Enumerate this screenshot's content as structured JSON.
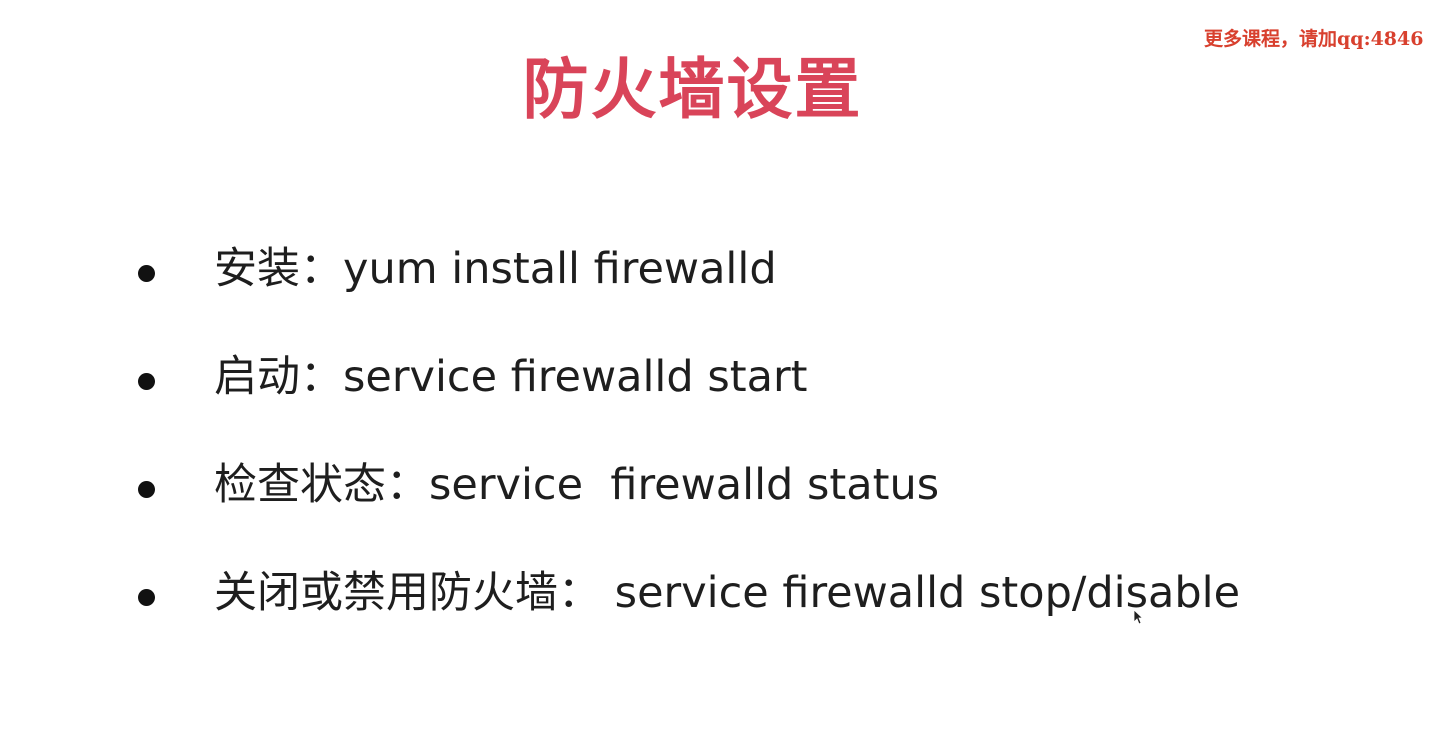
{
  "watermark": {
    "text": "更多课程，请加qq:4846"
  },
  "slide": {
    "title": "防火墙设置",
    "bullets": [
      {
        "text": "安装：yum install firewalld"
      },
      {
        "text": "启动：service firewalld start"
      },
      {
        "text": "检查状态：service  firewalld status"
      },
      {
        "text": "关闭或禁用防火墙： service firewalld stop/disable"
      }
    ]
  },
  "colors": {
    "title": "#d94459",
    "watermark": "#d8402e",
    "body_text": "#1e1e1e",
    "background": "#ffffff"
  },
  "icons": {
    "cursor": "mouse-pointer-icon"
  }
}
